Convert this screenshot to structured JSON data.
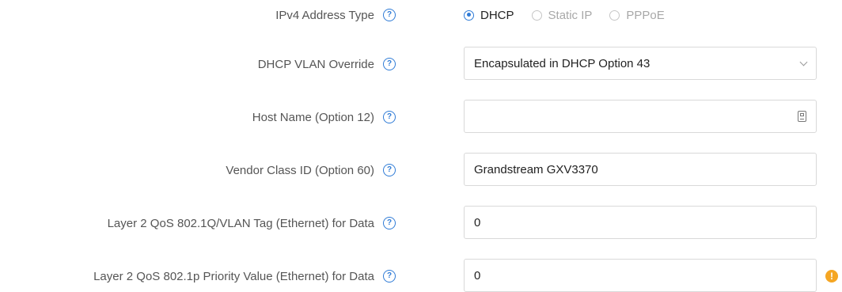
{
  "ipv4_address_type": {
    "label": "IPv4 Address Type",
    "options": [
      {
        "label": "DHCP",
        "selected": true
      },
      {
        "label": "Static IP",
        "selected": false
      },
      {
        "label": "PPPoE",
        "selected": false
      }
    ]
  },
  "dhcp_vlan_override": {
    "label": "DHCP VLAN Override",
    "value": "Encapsulated in DHCP Option 43"
  },
  "host_name": {
    "label": "Host Name (Option 12)",
    "value": ""
  },
  "vendor_class_id": {
    "label": "Vendor Class ID (Option 60)",
    "value": "Grandstream GXV3370"
  },
  "qos_vlan_tag": {
    "label": "Layer 2 QoS 802.1Q/VLAN Tag (Ethernet) for Data",
    "value": "0"
  },
  "qos_priority": {
    "label": "Layer 2 QoS 802.1p Priority Value (Ethernet) for Data",
    "value": "0",
    "warning_icon": "!"
  },
  "help_icon_glyph": "?",
  "colors": {
    "accent": "#2f7bd6",
    "warning": "#f5a623",
    "label_text": "#555555",
    "border": "#d9d9d9"
  }
}
